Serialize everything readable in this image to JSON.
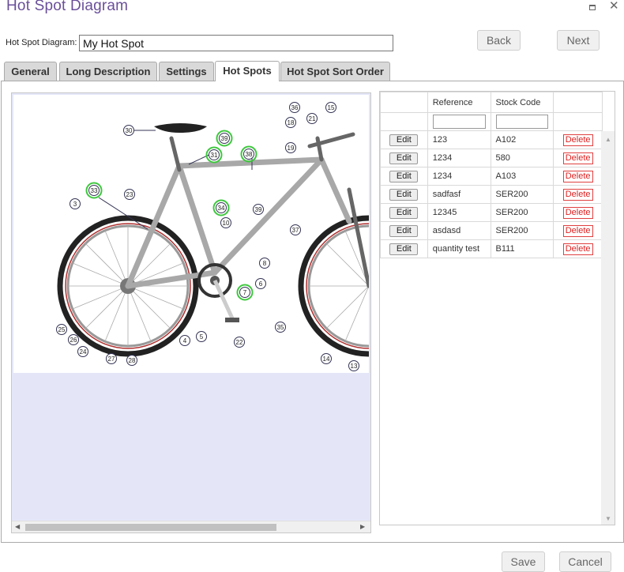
{
  "window": {
    "title": "Hot Spot Diagram",
    "maximize_icon": "maximize-icon",
    "close_icon": "close-icon",
    "close_glyph": "✕"
  },
  "header": {
    "name_label": "Hot Spot Diagram:",
    "name_value": "My Hot Spot",
    "back_label": "Back",
    "next_label": "Next"
  },
  "tabs": [
    {
      "label": "General"
    },
    {
      "label": "Long Description"
    },
    {
      "label": "Settings"
    },
    {
      "label": "Hot Spots",
      "active": true
    },
    {
      "label": "Hot Spot Sort Order"
    }
  ],
  "diagram": {
    "callout_numbers": [
      "36",
      "15",
      "18",
      "21",
      "30",
      "39",
      "31",
      "38",
      "19",
      "33",
      "23",
      "3",
      "34",
      "10",
      "39",
      "37",
      "8",
      "6",
      "7",
      "35",
      "4",
      "5",
      "22",
      "25",
      "26",
      "24",
      "27",
      "28",
      "14",
      "13"
    ],
    "highlighted_callouts": [
      "31",
      "38",
      "33",
      "34",
      "39",
      "7"
    ],
    "highlight_color": "#3ec83e"
  },
  "grid": {
    "columns": [
      "",
      "Reference",
      "Stock Code",
      ""
    ],
    "edit_label": "Edit",
    "delete_label": "Delete",
    "rows": [
      {
        "reference": "123",
        "stock_code": "A102"
      },
      {
        "reference": "1234",
        "stock_code": "580"
      },
      {
        "reference": "1234",
        "stock_code": "A103"
      },
      {
        "reference": "sadfasf",
        "stock_code": "SER200"
      },
      {
        "reference": "12345",
        "stock_code": "SER200"
      },
      {
        "reference": "asdasd",
        "stock_code": "SER200"
      },
      {
        "reference": "quantity test",
        "stock_code": "B111"
      }
    ]
  },
  "footer": {
    "save_label": "Save",
    "cancel_label": "Cancel"
  }
}
